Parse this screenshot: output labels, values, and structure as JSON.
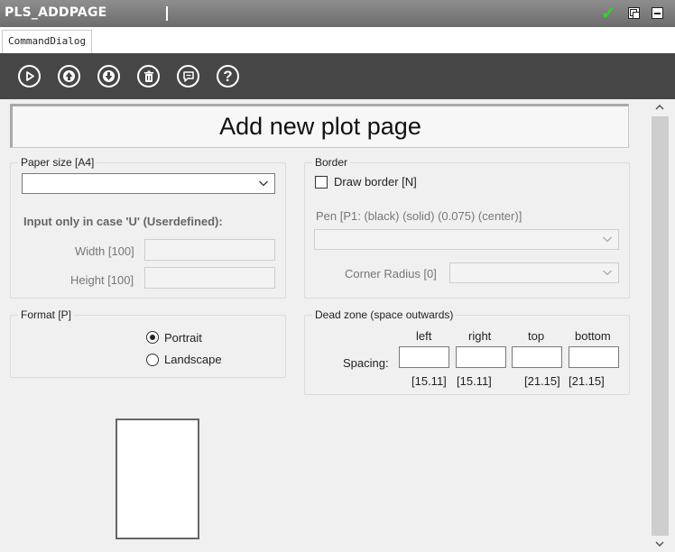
{
  "window": {
    "title": "PLS_ADDPAGE"
  },
  "tabs": [
    {
      "label": "CommandDialog"
    }
  ],
  "toolbar": {
    "icons": [
      "play-icon",
      "arrow-up-icon",
      "arrow-down-icon",
      "delete-icon",
      "comment-icon",
      "help-icon"
    ],
    "help_glyph": "?"
  },
  "header": {
    "title": "Add new plot page"
  },
  "paper_size": {
    "legend": "Paper size [A4]",
    "value": "",
    "userdefined_note": "Input only in case 'U' (Userdefined):",
    "width_label": "Width [100]",
    "width_value": "",
    "height_label": "Height [100]",
    "height_value": ""
  },
  "border": {
    "legend": "Border",
    "draw_border_label": "Draw border [N]",
    "draw_border_checked": false,
    "pen_label": "Pen [P1: (black) (solid) (0.075) (center)]",
    "pen_value": "",
    "corner_radius_label": "Corner Radius [0]",
    "corner_radius_value": ""
  },
  "format": {
    "legend": "Format [P]",
    "options": [
      {
        "label": "Portrait",
        "checked": true
      },
      {
        "label": "Landscape",
        "checked": false
      }
    ]
  },
  "dead_zone": {
    "legend": "Dead zone (space outwards)",
    "spacing_label": "Spacing:",
    "columns": [
      {
        "label": "left",
        "value": "",
        "default": "[15.11]"
      },
      {
        "label": "right",
        "value": "",
        "default": "[15.11]"
      },
      {
        "label": "top",
        "value": "",
        "default": "[21.15]"
      },
      {
        "label": "bottom",
        "value": "",
        "default": "[21.15]"
      }
    ]
  },
  "colors": {
    "toolbar_bg": "#464646",
    "check": "#2fd32f"
  }
}
